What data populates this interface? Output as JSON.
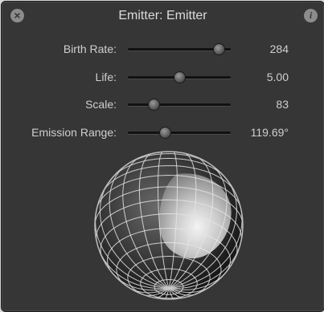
{
  "window": {
    "title": "Emitter: Emitter"
  },
  "icons": {
    "close": "close-icon",
    "info": "info-icon"
  },
  "params": [
    {
      "label": "Birth Rate:",
      "value": "284",
      "level": 0.88
    },
    {
      "label": "Life:",
      "value": "5.00",
      "level": 0.5
    },
    {
      "label": "Scale:",
      "value": "83",
      "level": 0.25
    },
    {
      "label": "Emission Range:",
      "value": "119.69°",
      "level": 0.36
    }
  ],
  "colors": {
    "panel": "#363636",
    "text": "#cfcfcf",
    "track": "#111111"
  }
}
